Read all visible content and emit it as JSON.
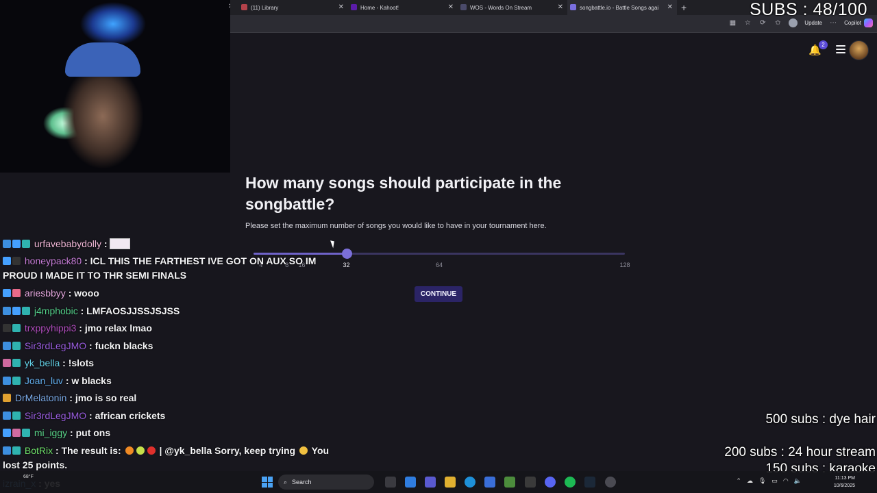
{
  "browser": {
    "tabs": [
      {
        "title": "(11) Library",
        "favicon_color": "#b3424a"
      },
      {
        "title": "Home - Kahoot!",
        "favicon_color": "#5b1ca8"
      },
      {
        "title": "WOS - Words On Stream",
        "favicon_color": "#4a4a6a"
      },
      {
        "title": "songbattle.io - Battle Songs agai",
        "favicon_color": "#7a6fe0"
      }
    ],
    "new_tab_icon": "plus-icon",
    "update_label": "Update",
    "copilot_label": "Copilot"
  },
  "page": {
    "notification_count": "2",
    "question": "How many songs should participate in the songbattle?",
    "subtitle": "Please set the maximum number of songs you would like to have in your tournament here.",
    "slider": {
      "ticks": [
        "4",
        "8",
        "16",
        "32",
        "64",
        "128"
      ],
      "selected": "32",
      "selected_fraction": 0.25
    },
    "continue_label": "CONTINUE",
    "accent": "#7b6fd8"
  },
  "overlay": {
    "subs_counter": "SUBS : 48/100",
    "goals": [
      "500 subs : dye hair",
      "200 subs : 24 hour stream",
      "150 subs : karaoke"
    ]
  },
  "chat": [
    {
      "user": "urfavebabydolly",
      "color": "#f0b6d6",
      "text": "",
      "emote": true
    },
    {
      "user": "honeypack80",
      "color": "#c77dd8",
      "text": "ICL THIS THE FARTHEST IVE GOT ON AUX SO IM PROUD I MADE IT TO THR SEMI FINALS"
    },
    {
      "user": "ariesbbyy",
      "color": "#e6a9e0",
      "text": "wooo"
    },
    {
      "user": "j4mphobic",
      "color": "#54d08a",
      "text": "LMFAOSJJSSJSJSS"
    },
    {
      "user": "trxppyhippi3",
      "color": "#b04dbd",
      "text": "jmo relax lmao"
    },
    {
      "user": "Sir3rdLegJMO",
      "color": "#9a5de0",
      "text": "fuckn blacks"
    },
    {
      "user": "yk_bella",
      "color": "#63d0e6",
      "text": "!slots"
    },
    {
      "user": "Joan_luv",
      "color": "#63b0f0",
      "text": "w blacks"
    },
    {
      "user": "DrMelatonin",
      "color": "#7aa9e6",
      "text": "jmo is so real"
    },
    {
      "user": "Sir3rdLegJMO",
      "color": "#9a5de0",
      "text": "african crickets"
    },
    {
      "user": "mi_iggy",
      "color": "#5ad68a",
      "text": "put ons"
    },
    {
      "user": "BotRix",
      "color": "#6ee06a",
      "text_a": "The result is:",
      "text_b": "| @yk_bella Sorry, keep trying",
      "text_c": "You lost 25 points."
    },
    {
      "user": "izrain_x",
      "color": "#64b5f6",
      "text": "yes"
    }
  ],
  "taskbar": {
    "weather": "68°F",
    "search_label": "Search",
    "time": "11:13 PM",
    "date": "10/6/2025"
  }
}
